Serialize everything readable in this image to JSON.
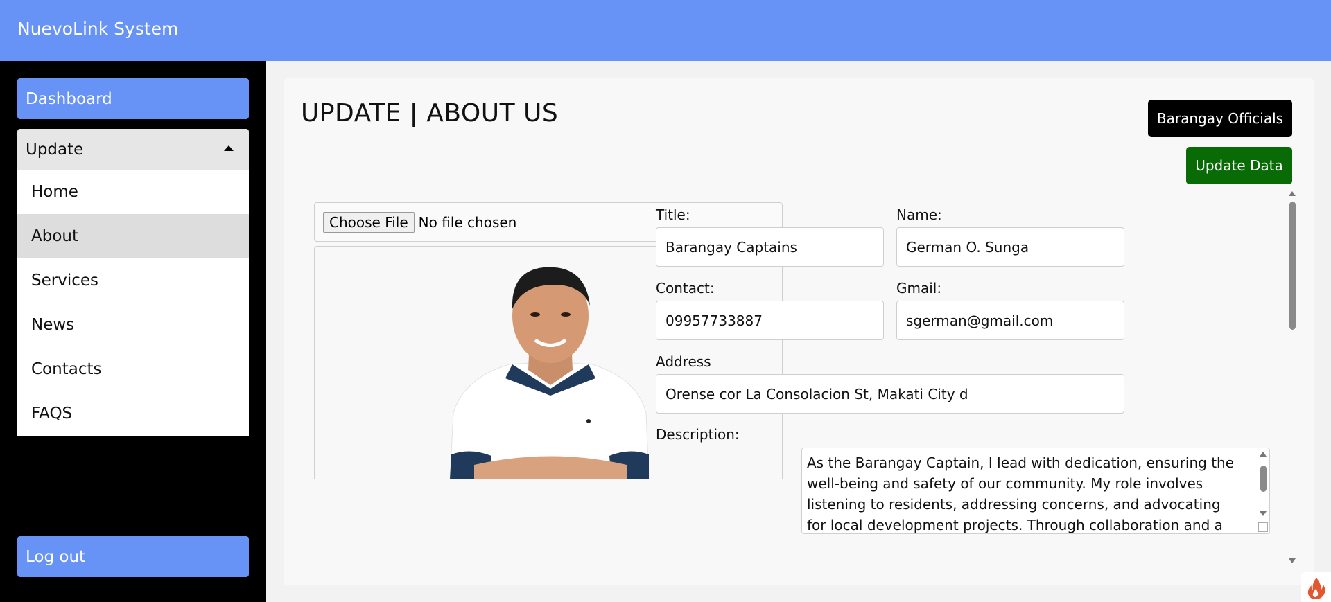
{
  "app": {
    "title": "NuevoLink System"
  },
  "sidebar": {
    "dashboard": "Dashboard",
    "update_toggle": "Update",
    "submenu": [
      {
        "label": "Home",
        "active": false
      },
      {
        "label": "About",
        "active": true
      },
      {
        "label": "Services",
        "active": false
      },
      {
        "label": "News",
        "active": false
      },
      {
        "label": "Contacts",
        "active": false
      },
      {
        "label": "FAQS",
        "active": false
      }
    ],
    "logout": "Log out"
  },
  "main": {
    "page_title": "UPDATE | ABOUT US",
    "officials_button": "Barangay Officials",
    "update_button": "Update Data",
    "file_input": {
      "button": "Choose File",
      "status": "No file chosen"
    },
    "form": {
      "title_label": "Title:",
      "title_value": "Barangay Captains",
      "name_label": "Name:",
      "name_value": "German O. Sunga",
      "contact_label": "Contact:",
      "contact_value": "09957733887",
      "gmail_label": "Gmail:",
      "gmail_value": "sgerman@gmail.com",
      "address_label": "Address",
      "address_value": "Orense cor La Consolacion St, Makati City d",
      "description_label": "Description:",
      "description_value": "As the Barangay Captain, I lead with dedication, ensuring the well-being and safety of our community. My role involves listening to residents, addressing concerns, and advocating for local development projects. Through collaboration and a"
    }
  },
  "colors": {
    "topbar": "#6893f6",
    "sidebar": "#000000",
    "update_button": "#086b05",
    "officials_button": "#000000"
  },
  "icons": {
    "toggle": "caret-up-icon",
    "corner": "fire-icon"
  }
}
